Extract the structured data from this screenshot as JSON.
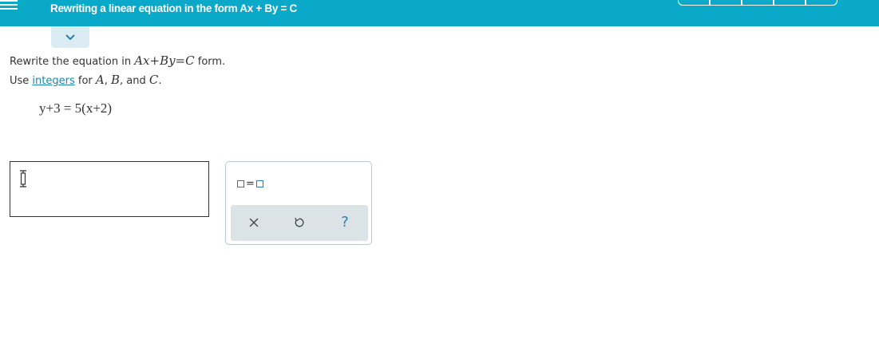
{
  "header": {
    "title": "Rewriting a linear equation in the form Ax + By = C",
    "menu_icon": "hamburger-menu-icon",
    "progress_segments": 5
  },
  "collapse_toggle": {
    "icon": "chevron-down-icon"
  },
  "prompt": {
    "line1_prefix": "Rewrite the equation in ",
    "line1_math": "Ax+By=C",
    "line1_suffix": " form.",
    "line2_prefix": "Use ",
    "line2_link": "integers",
    "line2_mid1": " for ",
    "var_a": "A",
    "sep1": ", ",
    "var_b": "B",
    "sep2": ", and ",
    "var_c": "C",
    "line2_end": "."
  },
  "equation": {
    "text": "y+3 = 5(x+2)"
  },
  "answer": {
    "value": ""
  },
  "toolbar": {
    "template_icon": "box-equals-box-icon",
    "clear_icon": "close-icon",
    "undo_icon": "undo-icon",
    "help_label": "?"
  },
  "colors": {
    "header_bg": "#0aa9c9",
    "accent": "#2a7fae",
    "link": "#1f86b0",
    "toolbar_bg": "#dbe3e7"
  }
}
